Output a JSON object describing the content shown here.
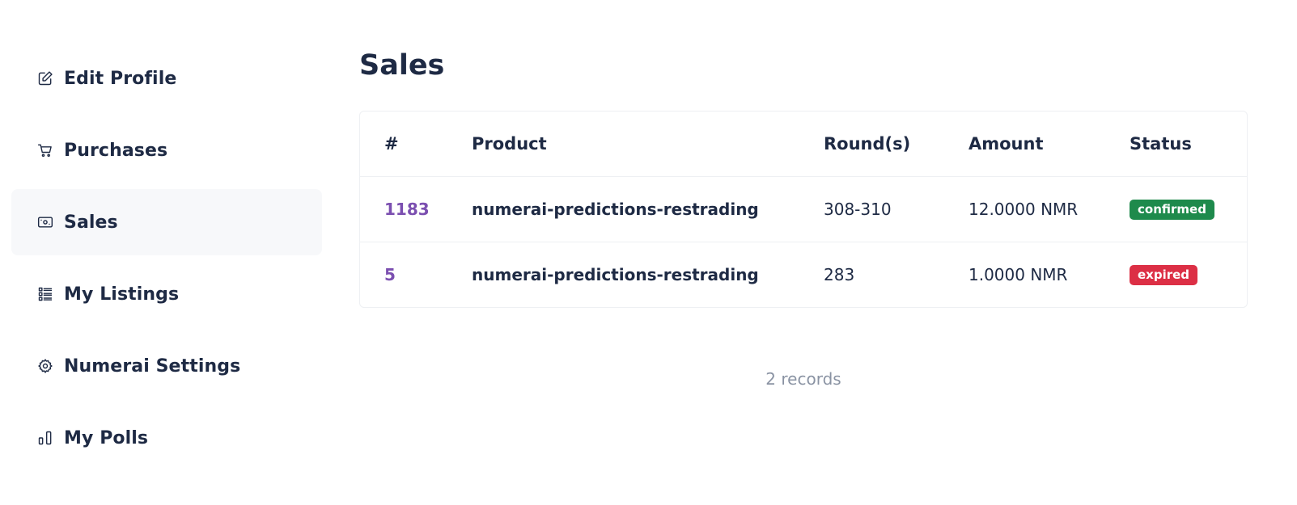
{
  "sidebar": {
    "items": [
      {
        "label": "Edit Profile",
        "icon": "edit-icon",
        "active": false
      },
      {
        "label": "Purchases",
        "icon": "cart-icon",
        "active": false
      },
      {
        "label": "Sales",
        "icon": "cash-icon",
        "active": true
      },
      {
        "label": "My Listings",
        "icon": "list-icon",
        "active": false
      },
      {
        "label": "Numerai Settings",
        "icon": "gear-icon",
        "active": false
      },
      {
        "label": "My Polls",
        "icon": "poll-icon",
        "active": false
      }
    ]
  },
  "main": {
    "title": "Sales",
    "table": {
      "headers": [
        "#",
        "Product",
        "Round(s)",
        "Amount",
        "Status"
      ],
      "rows": [
        {
          "id": "1183",
          "product": "numerai-predictions-restrading",
          "rounds": "308-310",
          "amount": "12.0000 NMR",
          "status": "confirmed",
          "status_color": "#1e8a4c"
        },
        {
          "id": "5",
          "product": "numerai-predictions-restrading",
          "rounds": "283",
          "amount": "1.0000 NMR",
          "status": "expired",
          "status_color": "#dc2f45"
        }
      ]
    },
    "records_text": "2 records"
  },
  "colors": {
    "text": "#1e2a44",
    "link": "#7b4fb0",
    "muted": "#8a93a3",
    "active_bg": "#f7f8fa"
  }
}
